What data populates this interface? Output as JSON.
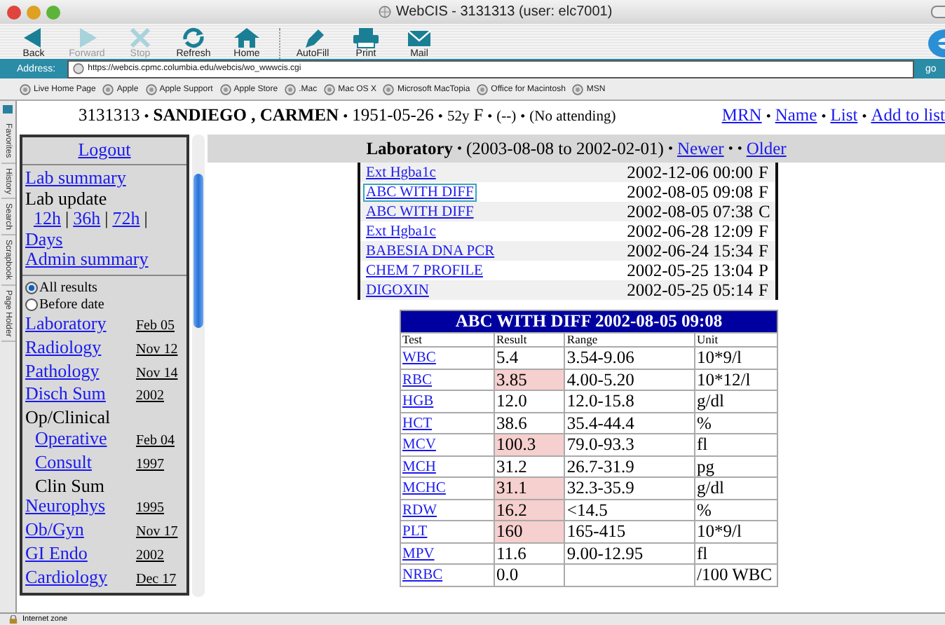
{
  "window": {
    "title": "WebCIS - 3131313 (user: elc7001)"
  },
  "toolbar": [
    {
      "label": "Back",
      "disabled": false
    },
    {
      "label": "Forward",
      "disabled": true
    },
    {
      "label": "Stop",
      "disabled": true
    },
    {
      "label": "Refresh",
      "disabled": false
    },
    {
      "label": "Home",
      "disabled": false
    },
    {
      "label": "AutoFill",
      "disabled": false
    },
    {
      "label": "Print",
      "disabled": false
    },
    {
      "label": "Mail",
      "disabled": false
    }
  ],
  "address": {
    "label": "Address:",
    "value": "https://webcis.cpmc.columbia.edu/webcis/wo_wwwcis.cgi",
    "go": "go"
  },
  "favorites": [
    "Live Home Page",
    "Apple",
    "Apple Support",
    "Apple Store",
    ".Mac",
    "Mac OS X",
    "Microsoft MacTopia",
    "Office for Macintosh",
    "MSN"
  ],
  "side_tabs": [
    "Favorites",
    "History",
    "Search",
    "Scrapbook",
    "Page Holder"
  ],
  "patient_header": [
    {
      "kind": "plain",
      "text": "3131313"
    },
    {
      "kind": "bullet",
      "text": "•"
    },
    {
      "kind": "bold",
      "text": "SANDIEGO , CARMEN"
    },
    {
      "kind": "bullet",
      "text": "•"
    },
    {
      "kind": "plain",
      "text": "1951-05-26"
    },
    {
      "kind": "bullet",
      "text": "•"
    },
    {
      "kind": "small",
      "text": "52y"
    },
    {
      "kind": "plain",
      "text": "F"
    },
    {
      "kind": "bullet",
      "text": "•"
    },
    {
      "kind": "small",
      "text": "(--)"
    },
    {
      "kind": "bullet",
      "text": "•"
    },
    {
      "kind": "small",
      "text": "(No attending)"
    }
  ],
  "patient_links": [
    {
      "kind": "link",
      "text": "MRN"
    },
    {
      "kind": "bullet",
      "text": "•"
    },
    {
      "kind": "link",
      "text": "Name"
    },
    {
      "kind": "bullet",
      "text": "•"
    },
    {
      "kind": "link",
      "text": "List"
    },
    {
      "kind": "bullet",
      "text": "•"
    },
    {
      "kind": "link",
      "text": "Add to list"
    }
  ],
  "sidebar": {
    "logout": "Logout",
    "summary": [
      {
        "kind": "link",
        "text": "Lab summary"
      },
      {
        "kind": "text",
        "text": "Lab update"
      },
      {
        "kind": "hours",
        "items": [
          "12h",
          "|",
          "36h",
          "|",
          "72h",
          "|"
        ]
      },
      {
        "kind": "link",
        "text": "Days"
      },
      {
        "kind": "link",
        "text": "Admin summary"
      }
    ],
    "filters": [
      {
        "label": "All results",
        "selected": true
      },
      {
        "label": "Before date",
        "selected": false
      }
    ],
    "items": [
      {
        "label": "Laboratory",
        "date": "Feb 05",
        "link": true
      },
      {
        "label": "Radiology",
        "date": "Nov 12",
        "link": true
      },
      {
        "label": "Pathology",
        "date": "Nov 14",
        "link": true
      },
      {
        "label": "Disch Sum",
        "date": "2002",
        "link": true
      },
      {
        "label": "Op/Clinical",
        "link": false,
        "children": [
          {
            "label": "Operative",
            "date": "Feb 04",
            "link": true
          },
          {
            "label": "Consult",
            "date": "1997",
            "link": true
          },
          {
            "label": "Clin Sum",
            "link": false
          }
        ]
      },
      {
        "label": "Neurophys",
        "date": "1995",
        "link": true
      },
      {
        "label": "Ob/Gyn",
        "date": "Nov 17",
        "link": true
      },
      {
        "label": "GI Endo",
        "date": "2002",
        "link": true
      },
      {
        "label": "Cardiology",
        "date": "Dec 17",
        "link": true
      }
    ]
  },
  "lab_header": [
    {
      "kind": "bold",
      "text": "Laboratory"
    },
    {
      "kind": "bullet",
      "text": "•"
    },
    {
      "kind": "plain",
      "text": "(2003-08-08 to 2002-02-01)"
    },
    {
      "kind": "bullet",
      "text": "•"
    },
    {
      "kind": "link",
      "text": "Newer"
    },
    {
      "kind": "bullet",
      "text": "•"
    },
    {
      "kind": "bullet",
      "text": "•"
    },
    {
      "kind": "link",
      "text": "Older"
    }
  ],
  "lab_list": [
    {
      "name": "Ext Hgba1c",
      "datetime": "2002-12-06 00:00",
      "status": "F",
      "focused": false
    },
    {
      "name": "ABC WITH DIFF",
      "datetime": "2002-08-05 09:08",
      "status": "F",
      "focused": true
    },
    {
      "name": "ABC WITH DIFF",
      "datetime": "2002-08-05 07:38",
      "status": "C",
      "focused": false
    },
    {
      "name": "Ext Hgba1c",
      "datetime": "2002-06-28 12:09",
      "status": "F",
      "focused": false
    },
    {
      "name": "BABESIA DNA PCR",
      "datetime": "2002-06-24 15:34",
      "status": "F",
      "focused": false
    },
    {
      "name": "CHEM 7 PROFILE",
      "datetime": "2002-05-25 13:04",
      "status": "P",
      "focused": false
    },
    {
      "name": "DIGOXIN",
      "datetime": "2002-05-25 05:14",
      "status": "F",
      "focused": false
    }
  ],
  "result_table": {
    "title": "ABC WITH DIFF 2002-08-05 09:08",
    "columns": [
      "Test",
      "Result",
      "Range",
      "Unit"
    ],
    "rows": [
      {
        "test": "WBC",
        "result": "5.4",
        "range": "3.54-9.06",
        "unit": "10*9/l",
        "abnormal": false
      },
      {
        "test": "RBC",
        "result": "3.85",
        "range": "4.00-5.20",
        "unit": "10*12/l",
        "abnormal": true
      },
      {
        "test": "HGB",
        "result": "12.0",
        "range": "12.0-15.8",
        "unit": "g/dl",
        "abnormal": false
      },
      {
        "test": "HCT",
        "result": "38.6",
        "range": "35.4-44.4",
        "unit": "%",
        "abnormal": false
      },
      {
        "test": "MCV",
        "result": "100.3",
        "range": "79.0-93.3",
        "unit": "fl",
        "abnormal": true
      },
      {
        "test": "MCH",
        "result": "31.2",
        "range": "26.7-31.9",
        "unit": "pg",
        "abnormal": false
      },
      {
        "test": "MCHC",
        "result": "31.1",
        "range": "32.3-35.9",
        "unit": "g/dl",
        "abnormal": true
      },
      {
        "test": "RDW",
        "result": "16.2",
        "range": "<14.5",
        "unit": "%",
        "abnormal": true
      },
      {
        "test": "PLT",
        "result": "160",
        "range": "165-415",
        "unit": "10*9/l",
        "abnormal": true
      },
      {
        "test": "MPV",
        "result": "11.6",
        "range": "9.00-12.95",
        "unit": "fl",
        "abnormal": false
      },
      {
        "test": "NRBC",
        "result": "0.0",
        "unit": "/100 WBC",
        "abnormal": false
      }
    ]
  },
  "status_bar": "Internet zone"
}
